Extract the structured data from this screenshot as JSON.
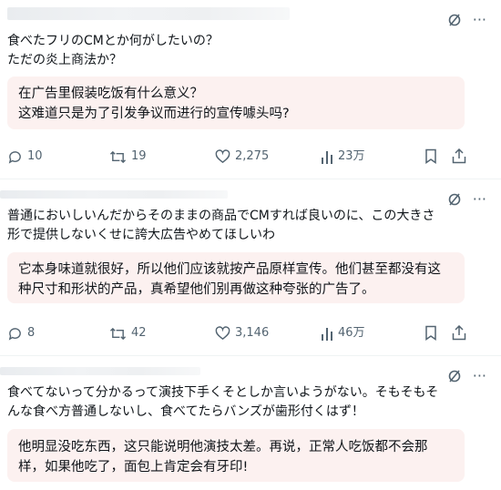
{
  "posts": [
    {
      "original": "食べたフリのCMとか何がしたいの？\nただの炎上商法か？",
      "translation": "在广告里假装吃饭有什么意义？\n这难道只是为了引发争议而进行的宣传噱头吗?",
      "stats": {
        "replies": "10",
        "reposts": "19",
        "likes": "2,275",
        "views": "23万"
      }
    },
    {
      "original": "普通においしいんだからそのままの商品でCMすれば良いのに、この大きさ\n形で提供しないくせに誇大広告やめてほしいわ",
      "translation": "它本身味道就很好，所以他们应该就按产品原样宣传。他们甚至都没有这\n种尺寸和形状的产品，真希望他们别再做这种夸张的广告了。",
      "stats": {
        "replies": "8",
        "reposts": "42",
        "likes": "3,146",
        "views": "46万"
      }
    },
    {
      "original": "食べてないって分かるって演技下手くそとしか言いようがない。そもそもそ\nんな食べ方普通しないし、食べてたらバンズが歯形付くはず！",
      "translation": "他明显没吃东西，这只能说明他演技太差。再说，正常人吃饭都不会那\n样，如果他吃了，面包上肯定会有牙印!"
    }
  ],
  "toolbar": {
    "more_label": "···"
  },
  "icons": [
    "grok-icon",
    "more-icon",
    "reply-icon",
    "repost-icon",
    "like-icon",
    "views-icon",
    "bookmark-icon",
    "share-icon"
  ],
  "colors": {
    "translation_bg": "#fcf1f0",
    "muted": "#536471",
    "text": "#0f1419",
    "divider": "#eff3f4"
  }
}
